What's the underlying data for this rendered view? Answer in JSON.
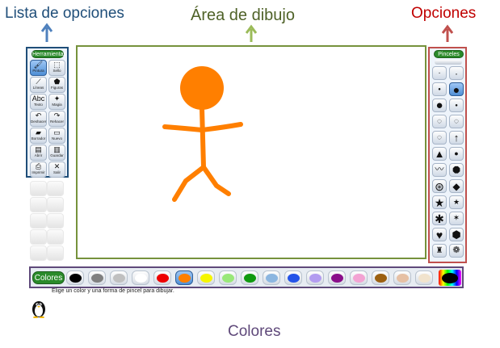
{
  "annotations": {
    "tool_list": "Lista de opciones",
    "drawing_area": "Área de dibujo",
    "options": "Opciones",
    "colors": "Colores"
  },
  "toolbox": {
    "title": "Herramientas",
    "tools": [
      {
        "label": "Pintura",
        "icon": "paintbrush-icon",
        "glyph": "🖌",
        "selected": true
      },
      {
        "label": "Sello",
        "icon": "stamp-icon",
        "glyph": "⬚",
        "selected": false
      },
      {
        "label": "Líneas",
        "icon": "lines-icon",
        "glyph": "⟋",
        "selected": false
      },
      {
        "label": "Figuras",
        "icon": "shapes-icon",
        "glyph": "⬟",
        "selected": false
      },
      {
        "label": "Texto",
        "icon": "text-icon",
        "glyph": "Abc",
        "selected": false
      },
      {
        "label": "Magia",
        "icon": "magic-wand-icon",
        "glyph": "✦",
        "selected": false
      },
      {
        "label": "Deshacer",
        "icon": "undo-icon",
        "glyph": "↶",
        "selected": false
      },
      {
        "label": "Rehacer",
        "icon": "redo-icon",
        "glyph": "↷",
        "selected": false
      },
      {
        "label": "Borrador",
        "icon": "eraser-icon",
        "glyph": "▰",
        "selected": false
      },
      {
        "label": "Nuevo",
        "icon": "new-page-icon",
        "glyph": "▭",
        "selected": false
      },
      {
        "label": "Abrir",
        "icon": "open-icon",
        "glyph": "▤",
        "selected": false
      },
      {
        "label": "Guardar",
        "icon": "save-icon",
        "glyph": "▥",
        "selected": false
      },
      {
        "label": "Imprimir",
        "icon": "print-icon",
        "glyph": "⎙",
        "selected": false
      },
      {
        "label": "Salir",
        "icon": "exit-icon",
        "glyph": "✕",
        "selected": false
      }
    ]
  },
  "brushes": {
    "title": "Pinceles",
    "items": [
      {
        "icon": "tiny-dot-brush-icon",
        "glyph": "·",
        "size": 10,
        "selected": false
      },
      {
        "icon": "tiny-dot-brush-icon",
        "glyph": "·",
        "size": 12,
        "selected": false
      },
      {
        "icon": "small-dot-brush-icon",
        "glyph": "●",
        "size": 6,
        "selected": false
      },
      {
        "icon": "large-dot-brush-icon",
        "glyph": "●",
        "size": 14,
        "selected": true
      },
      {
        "icon": "big-dot-brush-icon",
        "glyph": "●",
        "size": 15,
        "selected": false
      },
      {
        "icon": "fuzzy-dot-brush-icon",
        "glyph": "●",
        "size": 6,
        "selected": false
      },
      {
        "icon": "blur-brush-icon",
        "glyph": "◌",
        "size": 10,
        "selected": false
      },
      {
        "icon": "blur-brush-icon",
        "glyph": "◌",
        "size": 10,
        "selected": false
      },
      {
        "icon": "blur-brush-icon",
        "glyph": "◌",
        "size": 10,
        "selected": false
      },
      {
        "icon": "arrow-up-brush-icon",
        "glyph": "↑",
        "size": 13,
        "selected": false
      },
      {
        "icon": "triangle-brush-icon",
        "glyph": "▲",
        "size": 13,
        "selected": false
      },
      {
        "icon": "dot-brush-icon",
        "glyph": "●",
        "size": 9,
        "selected": false
      },
      {
        "icon": "wave-brush-icon",
        "glyph": "〰",
        "size": 11,
        "selected": false
      },
      {
        "icon": "octagon-brush-icon",
        "glyph": "⯃",
        "size": 12,
        "selected": false
      },
      {
        "icon": "ring-brush-icon",
        "glyph": "⊛",
        "size": 14,
        "selected": false
      },
      {
        "icon": "diamond-brush-icon",
        "glyph": "◆",
        "size": 12,
        "selected": false
      },
      {
        "icon": "star-brush-icon",
        "glyph": "★",
        "size": 14,
        "selected": false
      },
      {
        "icon": "small-star-brush-icon",
        "glyph": "★",
        "size": 9,
        "selected": false
      },
      {
        "icon": "asterisk-brush-icon",
        "glyph": "✱",
        "size": 14,
        "selected": false
      },
      {
        "icon": "sparkle-brush-icon",
        "glyph": "✶",
        "size": 10,
        "selected": false
      },
      {
        "icon": "heart-brush-icon",
        "glyph": "♥",
        "size": 14,
        "selected": false
      },
      {
        "icon": "hexagon-brush-icon",
        "glyph": "⬢",
        "size": 13,
        "selected": false
      },
      {
        "icon": "figure-brush-icon",
        "glyph": "♜",
        "size": 10,
        "selected": false
      },
      {
        "icon": "flower-brush-icon",
        "glyph": "❁",
        "size": 11,
        "selected": false
      }
    ]
  },
  "colors": {
    "title": "Colores",
    "swatches": [
      {
        "name": "black",
        "hex": "#000000",
        "selected": false
      },
      {
        "name": "dark-gray",
        "hex": "#808080",
        "selected": false
      },
      {
        "name": "light-gray",
        "hex": "#c0c0c0",
        "selected": false
      },
      {
        "name": "white",
        "hex": "#ffffff",
        "selected": false
      },
      {
        "name": "red",
        "hex": "#ee0000",
        "selected": false
      },
      {
        "name": "orange",
        "hex": "#ff7f00",
        "selected": true
      },
      {
        "name": "yellow",
        "hex": "#f6f600",
        "selected": false
      },
      {
        "name": "light-green",
        "hex": "#99e879",
        "selected": false
      },
      {
        "name": "green",
        "hex": "#109a10",
        "selected": false
      },
      {
        "name": "sky-blue",
        "hex": "#8cb6e0",
        "selected": false
      },
      {
        "name": "blue",
        "hex": "#2453e8",
        "selected": false
      },
      {
        "name": "lavender",
        "hex": "#b39cf0",
        "selected": false
      },
      {
        "name": "purple",
        "hex": "#8a0e8a",
        "selected": false
      },
      {
        "name": "pink",
        "hex": "#f3a3d3",
        "selected": false
      },
      {
        "name": "brown",
        "hex": "#9c6010",
        "selected": false
      },
      {
        "name": "tan",
        "hex": "#e6c0a4",
        "selected": false
      },
      {
        "name": "beige",
        "hex": "#f1e3cd",
        "selected": false
      }
    ]
  },
  "status": {
    "message": "Elige un color y una forma de pincel para dibujar."
  },
  "theme": {
    "tool_list_color": "#1f4e79",
    "drawing_area_color": "#76923c",
    "options_color": "#c0504d",
    "colors_color": "#5f497a",
    "stick_figure_color": "#ff7f00"
  }
}
